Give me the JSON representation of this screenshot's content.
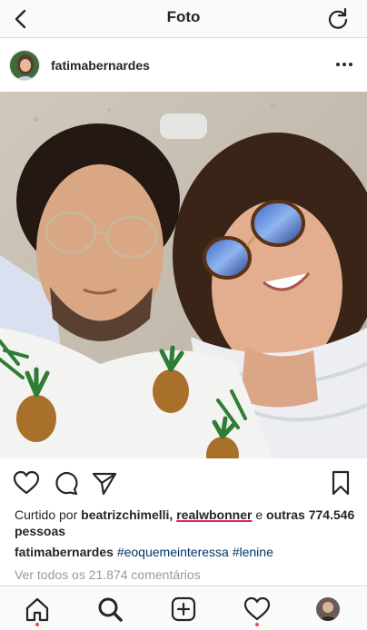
{
  "topbar": {
    "title": "Foto"
  },
  "post": {
    "username": "fatimabernardes",
    "likes": {
      "prefix": "Curtido por",
      "user1": "beatrizchimelli,",
      "user2": "realwbonner",
      "connector": "e",
      "count_text": "outras 774.546 pessoas"
    },
    "caption": {
      "username": "fatimabernardes",
      "hashtag1": "#eoquemeinteressa",
      "hashtag2": "#lenine"
    },
    "view_comments": "Ver todos os 21.874 comentários"
  },
  "colors": {
    "accent": "#ed4956",
    "hashtag": "#003569",
    "muted": "#999999"
  }
}
